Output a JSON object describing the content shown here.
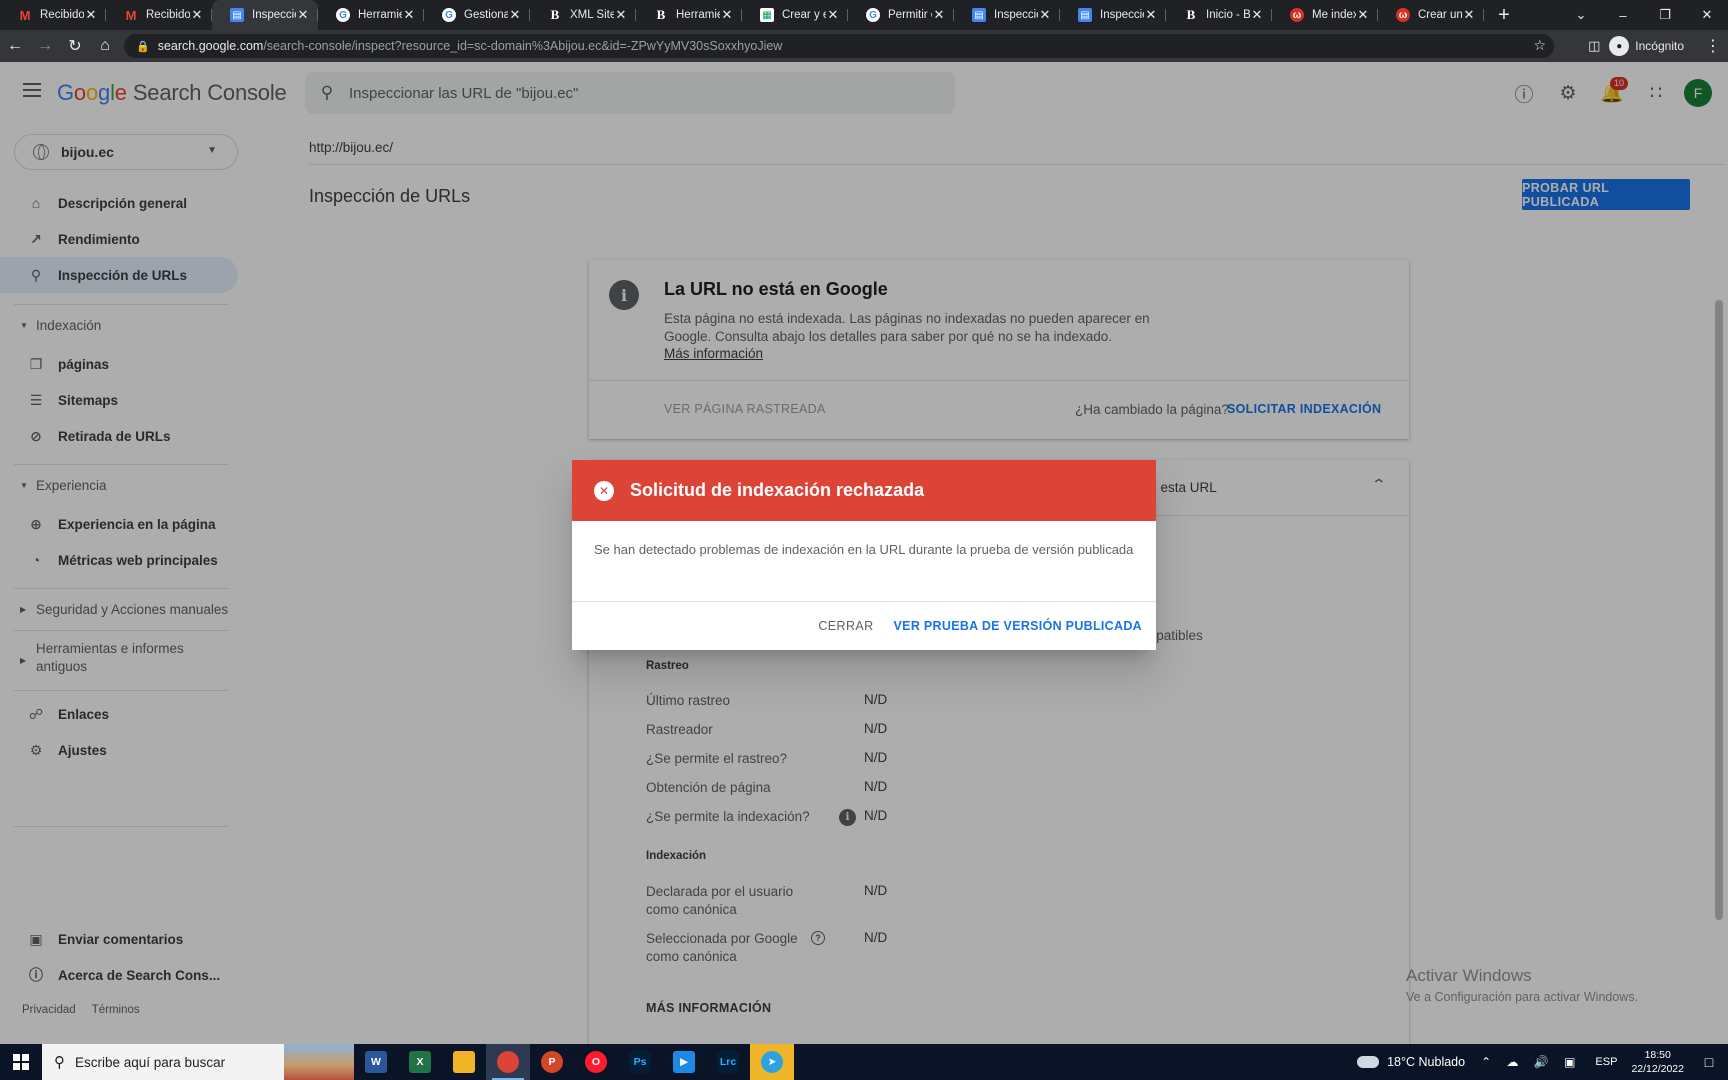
{
  "browser": {
    "tabs": [
      {
        "title": "Recibidos",
        "favicon": "gmail-icon",
        "active": false
      },
      {
        "title": "Recibidos",
        "favicon": "gmail-icon",
        "active": false
      },
      {
        "title": "Inspección",
        "favicon": "search-console-icon",
        "active": true
      },
      {
        "title": "Herramien",
        "favicon": "google-icon",
        "active": false
      },
      {
        "title": "Gestionar",
        "favicon": "google-icon",
        "active": false
      },
      {
        "title": "XML Siten",
        "favicon": "b-icon",
        "active": false
      },
      {
        "title": "Herramien",
        "favicon": "b-icon",
        "active": false
      },
      {
        "title": "Crear y en",
        "favicon": "sheet-icon",
        "active": false
      },
      {
        "title": "Permitir e",
        "favicon": "google-icon",
        "active": false
      },
      {
        "title": "Inspecció",
        "favicon": "search-console-icon",
        "active": false
      },
      {
        "title": "Inspecció",
        "favicon": "search-console-icon",
        "active": false
      },
      {
        "title": "Inicio - Bi",
        "favicon": "b-icon",
        "active": false
      },
      {
        "title": "Me index",
        "favicon": "red-icon",
        "active": false
      },
      {
        "title": "Crear un s",
        "favicon": "red-icon",
        "active": false
      }
    ],
    "url_host": "search.google.com",
    "url_path": "/search-console/inspect?resource_id=sc-domain%3Abijou.ec&id=-ZPwYyMV30sSoxxhyoJiew",
    "profile_label": "Incógnito"
  },
  "header": {
    "logo_letters": [
      "G",
      "o",
      "o",
      "g",
      "l",
      "e"
    ],
    "product_name": "Search Console",
    "search_placeholder": "Inspeccionar las URL de \"bijou.ec\"",
    "notification_count": "10",
    "avatar_initial": "F"
  },
  "sidebar": {
    "property": "bijou.ec",
    "items": [
      {
        "label": "Descripción general",
        "icon": "home-icon"
      },
      {
        "label": "Rendimiento",
        "icon": "trending-up-icon"
      },
      {
        "label": "Inspección de URLs",
        "icon": "search-icon",
        "active": true
      }
    ],
    "indexing_section": "Indexación",
    "indexing_items": [
      {
        "label": "páginas",
        "icon": "pages-icon"
      },
      {
        "label": "Sitemaps",
        "icon": "sitemap-icon"
      },
      {
        "label": "Retirada de URLs",
        "icon": "visibility-off-icon"
      }
    ],
    "experience_section": "Experiencia",
    "experience_items": [
      {
        "label": "Experiencia en la página",
        "icon": "plus-circle-icon"
      },
      {
        "label": "Métricas web principales",
        "icon": "speed-icon"
      }
    ],
    "security_section": "Seguridad y Acciones manuales",
    "legacy_section": "Herramientas e informes antiguos",
    "other_items": [
      {
        "label": "Enlaces",
        "icon": "links-icon"
      },
      {
        "label": "Ajustes",
        "icon": "gear-icon"
      }
    ],
    "bottom_items": [
      {
        "label": "Enviar comentarios",
        "icon": "feedback-icon"
      },
      {
        "label": "Acerca de Search Cons...",
        "icon": "info-icon"
      }
    ],
    "footer_privacy": "Privacidad",
    "footer_terms": "Términos"
  },
  "main": {
    "inspected_url": "http://bijou.ec/",
    "page_title": "Inspección de URLs",
    "test_live_button": "PROBAR URL PUBLICADA",
    "status_card": {
      "title": "La URL no está en Google",
      "description": "Esta página no está indexada. Las páginas no indexadas no pueden aparecer en Google. Consulta abajo los detalles para saber por qué no se ha indexado.",
      "learn_more": "Más información",
      "view_crawled": "VER PÁGINA RASTREADA",
      "changed_question": "¿Ha cambiado la página?",
      "request_indexing": "SOLICITAR INDEXACIÓN"
    },
    "coverage_card": {
      "header_fragment": "oce esta URL",
      "compat_fragment": "mpatibles",
      "crawl_section": "Rastreo",
      "crawl_rows": [
        {
          "label": "Último rastreo",
          "value": "N/D"
        },
        {
          "label": "Rastreador",
          "value": "N/D"
        },
        {
          "label": "¿Se permite el rastreo?",
          "value": "N/D"
        },
        {
          "label": "Obtención de página",
          "value": "N/D"
        },
        {
          "label": "¿Se permite la indexación?",
          "value": "N/D"
        }
      ],
      "index_section": "Indexación",
      "index_rows": [
        {
          "label": "Declarada por el usuario como canónica",
          "value": "N/D"
        },
        {
          "label": "Seleccionada por Google como canónica",
          "value": "N/D"
        }
      ],
      "more_info": "MÁS INFORMACIÓN"
    },
    "watermark_line1": "Activar Windows",
    "watermark_line2": "Ve a Configuración para activar Windows."
  },
  "dialog": {
    "title": "Solicitud de indexación rechazada",
    "body": "Se han detectado problemas de indexación en la URL durante la prueba de versión publicada",
    "close_button": "CERRAR",
    "view_button": "VER PRUEBA DE VERSIÓN PUBLICADA"
  },
  "taskbar": {
    "search_placeholder": "Escribe aquí para buscar",
    "weather": "18°C Nublado",
    "language": "ESP",
    "time": "18:50",
    "date": "22/12/2022"
  },
  "colors": {
    "primary_blue": "#1a73e8",
    "error_red": "#db4437",
    "active_nav_bg": "#e8f0fe"
  }
}
